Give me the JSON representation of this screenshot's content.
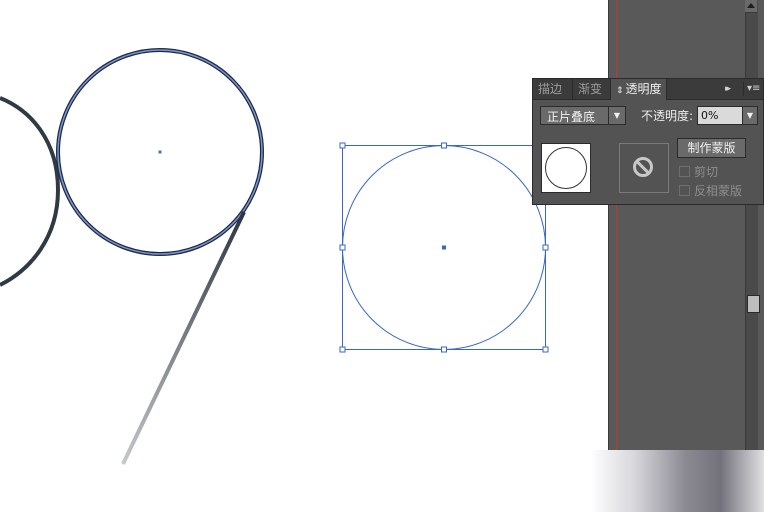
{
  "canvas": {
    "artwork": "numeral-9-stroke",
    "selected_object": "ellipse-with-bounding-box",
    "selection_color": "#3a66c9"
  },
  "dock": {
    "background": "#595959",
    "guide_color": "#c0392b"
  },
  "transparency_panel": {
    "tabs": [
      {
        "label": "描边",
        "active": false
      },
      {
        "label": "渐变",
        "active": false
      },
      {
        "label": "透明度",
        "active": true
      }
    ],
    "tab_updown_icon": "⇕",
    "expand_icon": "▸▸",
    "menu_icon": "▾≡",
    "blend_mode": "正片叠底",
    "opacity_label": "不透明度:",
    "opacity_value": "0%",
    "make_mask_label": "制作蒙版",
    "clip_label": "剪切",
    "invert_mask_label": "反相蒙版",
    "clip_checked": false,
    "invert_checked": false
  }
}
